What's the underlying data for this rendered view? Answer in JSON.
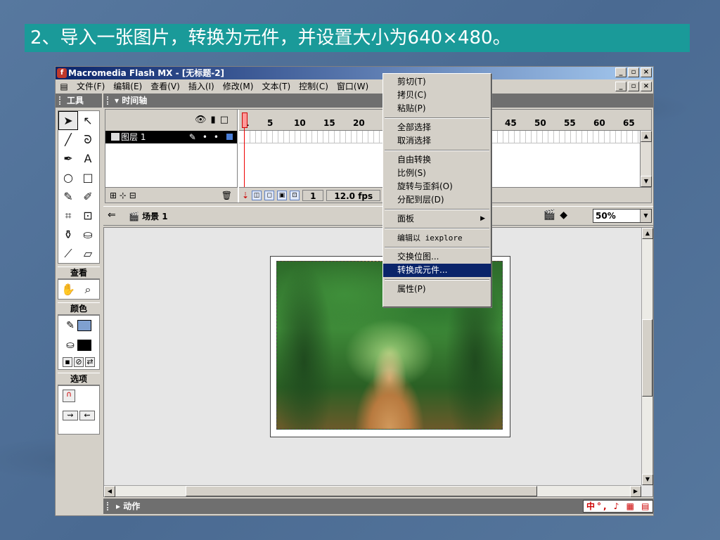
{
  "slide_title": "2、导入一张图片，转换为元件，并设置大小为640×480。",
  "window": {
    "title": "Macromedia Flash MX - [无标题-2]",
    "controls": [
      "_",
      "▫",
      "×"
    ]
  },
  "menubar": {
    "items": [
      "文件(F)",
      "编辑(E)",
      "查看(V)",
      "插入(I)",
      "修改(M)",
      "文本(T)",
      "控制(C)",
      "窗口(W)"
    ]
  },
  "tools_panel": {
    "header": "工具",
    "view_label": "查看",
    "colors_label": "颜色",
    "options_label": "选项"
  },
  "timeline": {
    "header": "时间轴",
    "layer_name": "图层 1",
    "frame_ticks": [
      "1",
      "5",
      "10",
      "15",
      "20",
      "45",
      "50",
      "55",
      "60",
      "65"
    ],
    "current_frame": "1",
    "fps": "12.0 fps"
  },
  "scene": {
    "name": "场景 1",
    "zoom": "50%"
  },
  "actions_panel": {
    "header": "动作",
    "ime": "中°, ♪ ▦ ▤"
  },
  "context_menu": {
    "groups": [
      [
        "剪切(T)",
        "拷贝(C)",
        "粘贴(P)"
      ],
      [
        "全部选择",
        "取消选择"
      ],
      [
        "自由转换",
        "比例(S)",
        "旋转与歪斜(O)",
        "分配到层(D)"
      ],
      [
        "面板"
      ],
      [
        "编辑以 iexplore"
      ],
      [
        "交换位图...",
        "转换成元件..."
      ],
      [
        "属性(P)"
      ]
    ],
    "highlighted": "转换成元件..."
  }
}
